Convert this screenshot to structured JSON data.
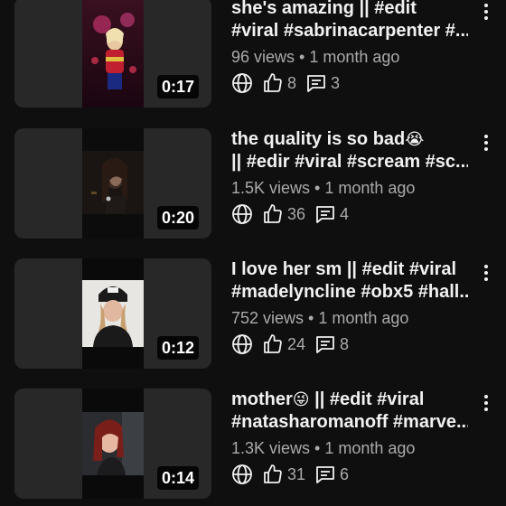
{
  "videos": [
    {
      "duration": "0:17",
      "title_line1": "she's amazing || #edit",
      "title_line2": "#viral #sabrinacarpenter #...",
      "views": "96 views",
      "separator": " • ",
      "age": "1 month ago",
      "likes": "8",
      "comments": "3"
    },
    {
      "duration": "0:20",
      "title_line1": "the quality is so bad",
      "title_emoji": "😭",
      "title_line2": "|| #edir #viral #scream #sc...",
      "views": "1.5K views",
      "separator": " • ",
      "age": "1 month ago",
      "likes": "36",
      "comments": "4"
    },
    {
      "duration": "0:12",
      "title_line1": "I love her sm || #edit #viral",
      "title_line2": "#madelyncline #obx5 #hall...",
      "views": "752 views",
      "separator": " • ",
      "age": "1 month ago",
      "likes": "24",
      "comments": "8"
    },
    {
      "duration": "0:14",
      "title_line1": "mother",
      "title_emoji": "😜",
      "title_line1_rest": " || #edit #viral",
      "title_line2": "#natasharomanoff #marve...",
      "views": "1.3K views",
      "separator": " • ",
      "age": "1 month ago",
      "likes": "31",
      "comments": "6"
    }
  ],
  "icons": {
    "visibility": "globe-icon",
    "likes": "thumbs-up-icon",
    "comments": "comment-icon",
    "menu": "more-vert-icon"
  },
  "colors": {
    "background": "#0f0f0f",
    "thumb_box": "#282828",
    "secondary_text": "#aaaaaa",
    "primary_text": "#f1f1f1"
  }
}
